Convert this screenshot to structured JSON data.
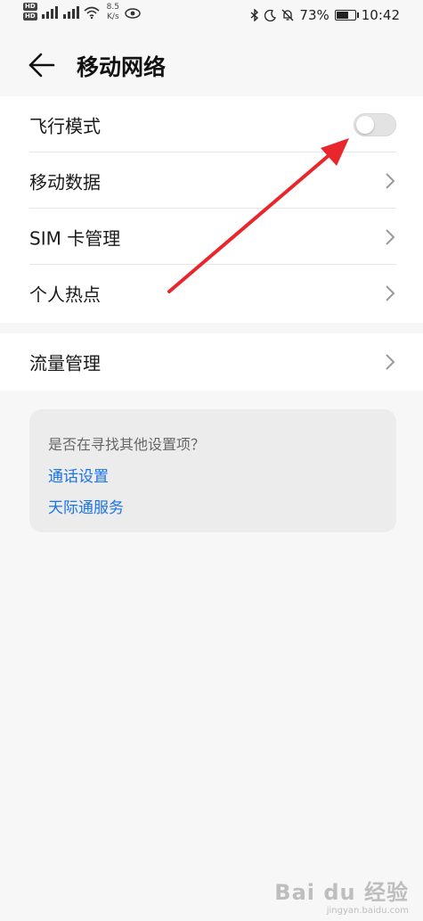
{
  "status_bar": {
    "hd_badge_1": "HD",
    "hd_badge_2": "HD",
    "net_speed_value": "8.5",
    "net_speed_unit": "K/s",
    "battery_percent": "73%",
    "battery_level": 0.73,
    "time": "10:42"
  },
  "header": {
    "title": "移动网络"
  },
  "settings_list": {
    "items": [
      {
        "label": "飞行模式",
        "toggle_on": false
      },
      {
        "label": "移动数据"
      },
      {
        "label": "SIM 卡管理"
      },
      {
        "label": "个人热点"
      }
    ]
  },
  "data_usage": {
    "label": "流量管理"
  },
  "suggestions": {
    "question": "是否在寻找其他设置项？",
    "links": [
      "通话设置",
      "天际通服务"
    ]
  },
  "watermark": {
    "logo": "Bai du 经验",
    "url": "jingyan.baidu.com"
  },
  "colors": {
    "accent_link": "#1a73e8",
    "arrow": "#e8262b"
  }
}
